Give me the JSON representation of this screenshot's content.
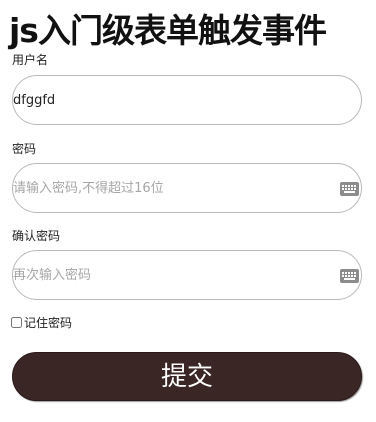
{
  "page": {
    "title": "js入门级表单触发事件"
  },
  "form": {
    "username": {
      "label": "用户名",
      "value": "dfggfd",
      "placeholder": ""
    },
    "password": {
      "label": "密码",
      "value": "",
      "placeholder": "请输入密码,不得超过16位",
      "icon": "keyboard-icon"
    },
    "confirm_password": {
      "label": "确认密码",
      "value": "",
      "placeholder": "再次输入密码",
      "icon": "keyboard-icon"
    },
    "remember": {
      "label": "记住密码",
      "checked": false
    },
    "submit_label": "提交"
  },
  "colors": {
    "submit_bg": "#3b2626",
    "field_border": "#b9b9b9",
    "placeholder": "#a6a6a6",
    "icon": "#8c8c8c"
  }
}
